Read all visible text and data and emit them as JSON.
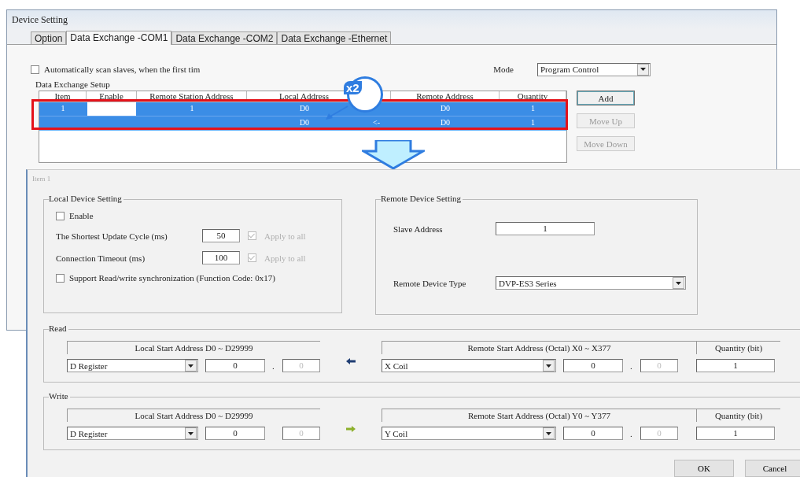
{
  "back_window": {
    "title": "Device Setting",
    "tabs": [
      {
        "label": "Option",
        "selected": false
      },
      {
        "label": "Data Exchange -COM1",
        "selected": true
      },
      {
        "label": "Data Exchange -COM2",
        "selected": false
      },
      {
        "label": "Data Exchange -Ethernet",
        "selected": false
      }
    ],
    "auto_scan": {
      "label": "Automatically scan slaves, when the first tim",
      "checked": false
    },
    "mode": {
      "label": "Mode",
      "value": "Program Control"
    },
    "group_title": "Data Exchange Setup",
    "table": {
      "columns": [
        "Item",
        "Enable",
        "Remote Station Address",
        "Local Address",
        "Remote Address",
        "Quantity"
      ],
      "rows": [
        {
          "item": "1",
          "enable_editing": true,
          "remote_station": "1",
          "local": "D0",
          "remote": "D0",
          "quantity": "1",
          "selected": true
        },
        {
          "local": "D0",
          "direction": "<-",
          "remote": "D0",
          "quantity": "1",
          "selected": true
        }
      ]
    },
    "buttons": [
      {
        "label": "Add",
        "disabled": false
      },
      {
        "label": "Move Up",
        "disabled": true
      },
      {
        "label": "Move Down",
        "disabled": true
      }
    ]
  },
  "callout": {
    "badge": "x2"
  },
  "dialog": {
    "title": "Item 1",
    "local": {
      "title": "Local Device Setting",
      "enable": {
        "label": "Enable",
        "checked": false
      },
      "fields": [
        {
          "label": "The Shortest Update Cycle (ms)",
          "value": "50",
          "apply_label": "Apply to all",
          "apply_checked": true
        },
        {
          "label": "Connection Timeout (ms)",
          "value": "100",
          "apply_label": "Apply to all",
          "apply_checked": true
        }
      ],
      "sync": {
        "label": "Support Read/write synchronization (Function Code: 0x17)",
        "checked": false
      }
    },
    "remote": {
      "title": "Remote Device Setting",
      "slave_label": "Slave Address",
      "slave_value": "1",
      "type_label": "Remote Device Type",
      "type_value": "DVP-ES3 Series"
    },
    "sections": [
      {
        "title": "Read",
        "kind": "read",
        "local_header": "Local Start Address D0 ~ D29999",
        "local_type": "D Register",
        "local_value": "0",
        "local_dot": ".",
        "local_sub": "0",
        "remote_header": "Remote Start Address (Octal) X0 ~ X377",
        "remote_type": "X Coil",
        "remote_value": "0",
        "remote_dot": ".",
        "remote_sub": "0",
        "quantity_header": "Quantity (bit)",
        "quantity": "1"
      },
      {
        "title": "Write",
        "kind": "write",
        "local_header": "Local Start Address D0 ~ D29999",
        "local_type": "D Register",
        "local_value": "0",
        "local_sub": "0",
        "remote_header": "Remote Start Address (Octal) Y0 ~ Y377",
        "remote_type": "Y Coil",
        "remote_value": "0",
        "remote_dot": ".",
        "remote_sub": "0",
        "quantity_header": "Quantity (bit)",
        "quantity": "1"
      }
    ],
    "buttons": [
      {
        "label": "OK"
      },
      {
        "label": "Cancel"
      }
    ]
  }
}
